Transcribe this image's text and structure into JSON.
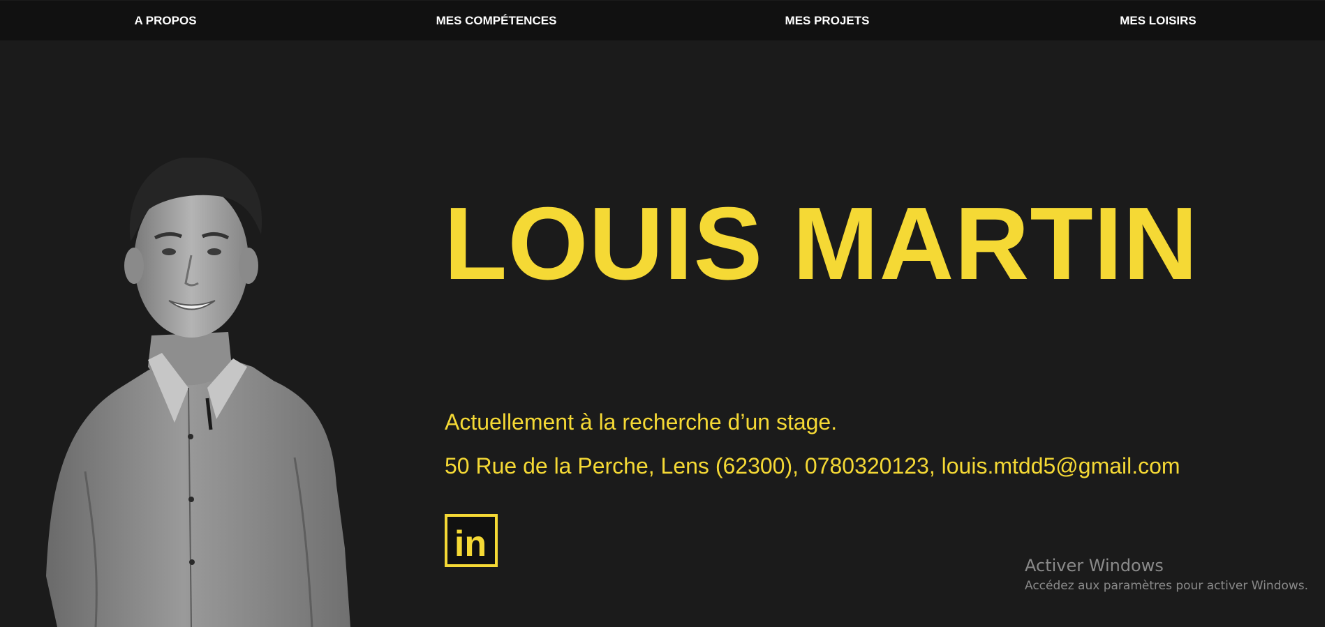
{
  "nav": {
    "items": [
      {
        "label": "A PROPOS"
      },
      {
        "label": "MES COMPÉTENCES"
      },
      {
        "label": "MES PROJETS"
      },
      {
        "label": "MES LOISIRS"
      }
    ]
  },
  "hero": {
    "name": "LOUIS MARTIN",
    "tagline": "Actuellement à la recherche d’un stage.",
    "contact": "50 Rue de la Perche, Lens (62300), 0780320123, louis.mtdd5@gmail.com",
    "linkedin_icon": "linkedin-icon",
    "linkedin_glyph": "in"
  },
  "windows_activation": {
    "title": "Activer Windows",
    "subtitle": "Accédez aux paramètres pour activer Windows."
  },
  "colors": {
    "background": "#1b1b1b",
    "navbar": "#111111",
    "accent": "#f5d935",
    "nav_text": "#ffffff"
  }
}
